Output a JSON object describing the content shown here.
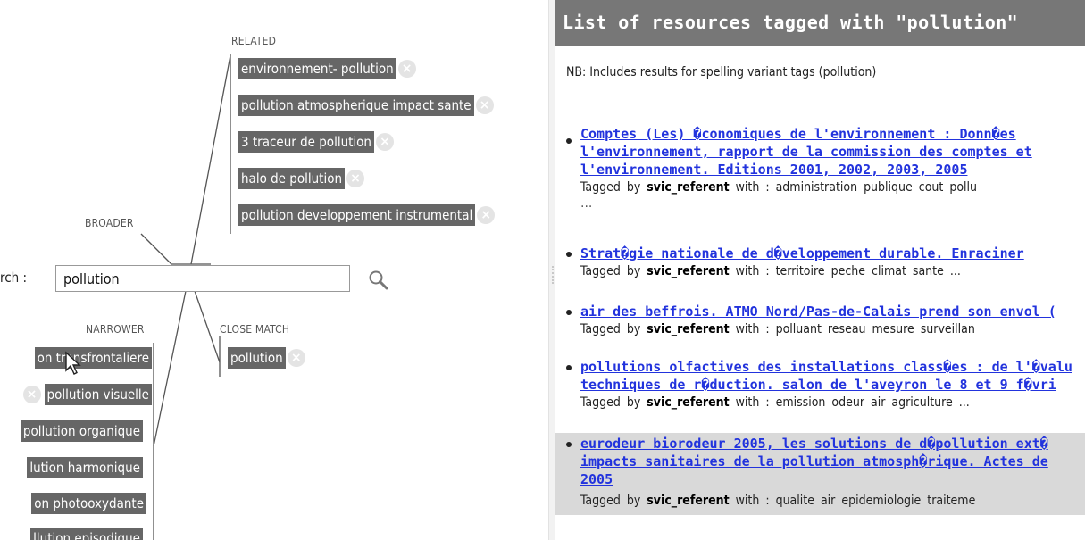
{
  "graph": {
    "labels": {
      "related": "RELATED",
      "broader": "BROADER",
      "narrower": "NARROWER",
      "close_match": "CLOSE MATCH"
    },
    "related": [
      "environnement- pollution",
      "pollution atmospherique impact sante",
      "3 traceur de pollution",
      "halo de pollution",
      "pollution developpement instrumental"
    ],
    "narrower": [
      "on transfrontaliere",
      "pollution visuelle",
      "pollution organique",
      "lution harmonique",
      "on photooxydante",
      "llution episodique"
    ],
    "close_match": [
      "pollution"
    ],
    "remove_glyph": "×"
  },
  "search": {
    "label": "rch :",
    "value": "pollution",
    "icon": "magnifier-icon"
  },
  "results_panel": {
    "title": "List of resources tagged with \"pollution\"",
    "note": "NB: Includes results for spelling variant tags (pollution)",
    "tagged_prefix": "Tagged by",
    "with_word": "with :",
    "items": [
      {
        "title_lines": [
          "Comptes (Les) �conomiques de l'environnement : Donn�es",
          "l'environnement, rapport de la commission des comptes et",
          "l'environnement. Editions 2001, 2002, 2003, 2005"
        ],
        "user": "svic_referent",
        "tags": "administration publique   cout   pollu",
        "more": "..."
      },
      {
        "title_lines": [
          "Strat�gie nationale de d�veloppement durable. Enraciner"
        ],
        "user": "svic_referent",
        "tags": "territoire   peche   climat   sante   ..."
      },
      {
        "title_lines": [
          "air des beffrois. ATMO Nord/Pas-de-Calais prend son envol ("
        ],
        "user": "svic_referent",
        "tags": "polluant   reseau mesure   surveillan"
      },
      {
        "title_lines": [
          "pollutions olfactives des installations class�es : de l'�valu",
          "techniques de r�duction. salon de l'aveyron le 8 et 9 f�vri"
        ],
        "user": "svic_referent",
        "tags": "emission   odeur   air   agriculture   ..."
      },
      {
        "title_lines": [
          "eurodeur biorodeur 2005, les solutions de d�pollution ext�",
          "impacts sanitaires de la pollution atmosph�rique. Actes de",
          "2005"
        ],
        "user": "svic_referent",
        "tags": "qualite air   epidemiologie   traiteme",
        "highlighted": true
      }
    ]
  },
  "colors": {
    "chip_bg": "#666666",
    "header_bg": "#777777",
    "link": "#2233dd",
    "highlight_row": "#d9d9d9"
  }
}
